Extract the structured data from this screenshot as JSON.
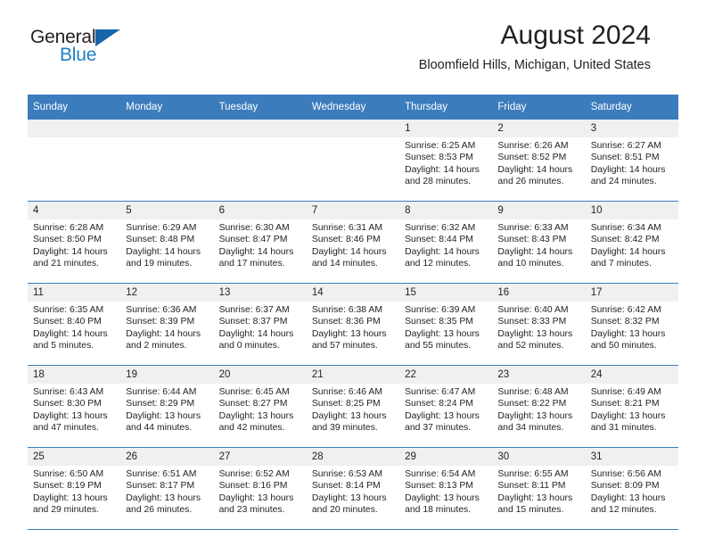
{
  "brand": {
    "name_part1": "General",
    "name_part2": "Blue",
    "color_dark": "#231f20",
    "color_blue": "#1f7fc4",
    "triangle_color": "#1565a8"
  },
  "header": {
    "title": "August 2024",
    "subtitle": "Bloomfield Hills, Michigan, United States"
  },
  "theme": {
    "header_bar": "#3b7cbd",
    "daynum_band": "#f0f0f0",
    "text": "#231f20"
  },
  "weekdays": [
    "Sunday",
    "Monday",
    "Tuesday",
    "Wednesday",
    "Thursday",
    "Friday",
    "Saturday"
  ],
  "weeks": [
    [
      {
        "day": "",
        "sunrise": "",
        "sunset": "",
        "daylight_line1": "",
        "daylight_line2": ""
      },
      {
        "day": "",
        "sunrise": "",
        "sunset": "",
        "daylight_line1": "",
        "daylight_line2": ""
      },
      {
        "day": "",
        "sunrise": "",
        "sunset": "",
        "daylight_line1": "",
        "daylight_line2": ""
      },
      {
        "day": "",
        "sunrise": "",
        "sunset": "",
        "daylight_line1": "",
        "daylight_line2": ""
      },
      {
        "day": "1",
        "sunrise": "Sunrise: 6:25 AM",
        "sunset": "Sunset: 8:53 PM",
        "daylight_line1": "Daylight: 14 hours",
        "daylight_line2": "and 28 minutes."
      },
      {
        "day": "2",
        "sunrise": "Sunrise: 6:26 AM",
        "sunset": "Sunset: 8:52 PM",
        "daylight_line1": "Daylight: 14 hours",
        "daylight_line2": "and 26 minutes."
      },
      {
        "day": "3",
        "sunrise": "Sunrise: 6:27 AM",
        "sunset": "Sunset: 8:51 PM",
        "daylight_line1": "Daylight: 14 hours",
        "daylight_line2": "and 24 minutes."
      }
    ],
    [
      {
        "day": "4",
        "sunrise": "Sunrise: 6:28 AM",
        "sunset": "Sunset: 8:50 PM",
        "daylight_line1": "Daylight: 14 hours",
        "daylight_line2": "and 21 minutes."
      },
      {
        "day": "5",
        "sunrise": "Sunrise: 6:29 AM",
        "sunset": "Sunset: 8:48 PM",
        "daylight_line1": "Daylight: 14 hours",
        "daylight_line2": "and 19 minutes."
      },
      {
        "day": "6",
        "sunrise": "Sunrise: 6:30 AM",
        "sunset": "Sunset: 8:47 PM",
        "daylight_line1": "Daylight: 14 hours",
        "daylight_line2": "and 17 minutes."
      },
      {
        "day": "7",
        "sunrise": "Sunrise: 6:31 AM",
        "sunset": "Sunset: 8:46 PM",
        "daylight_line1": "Daylight: 14 hours",
        "daylight_line2": "and 14 minutes."
      },
      {
        "day": "8",
        "sunrise": "Sunrise: 6:32 AM",
        "sunset": "Sunset: 8:44 PM",
        "daylight_line1": "Daylight: 14 hours",
        "daylight_line2": "and 12 minutes."
      },
      {
        "day": "9",
        "sunrise": "Sunrise: 6:33 AM",
        "sunset": "Sunset: 8:43 PM",
        "daylight_line1": "Daylight: 14 hours",
        "daylight_line2": "and 10 minutes."
      },
      {
        "day": "10",
        "sunrise": "Sunrise: 6:34 AM",
        "sunset": "Sunset: 8:42 PM",
        "daylight_line1": "Daylight: 14 hours",
        "daylight_line2": "and 7 minutes."
      }
    ],
    [
      {
        "day": "11",
        "sunrise": "Sunrise: 6:35 AM",
        "sunset": "Sunset: 8:40 PM",
        "daylight_line1": "Daylight: 14 hours",
        "daylight_line2": "and 5 minutes."
      },
      {
        "day": "12",
        "sunrise": "Sunrise: 6:36 AM",
        "sunset": "Sunset: 8:39 PM",
        "daylight_line1": "Daylight: 14 hours",
        "daylight_line2": "and 2 minutes."
      },
      {
        "day": "13",
        "sunrise": "Sunrise: 6:37 AM",
        "sunset": "Sunset: 8:37 PM",
        "daylight_line1": "Daylight: 14 hours",
        "daylight_line2": "and 0 minutes."
      },
      {
        "day": "14",
        "sunrise": "Sunrise: 6:38 AM",
        "sunset": "Sunset: 8:36 PM",
        "daylight_line1": "Daylight: 13 hours",
        "daylight_line2": "and 57 minutes."
      },
      {
        "day": "15",
        "sunrise": "Sunrise: 6:39 AM",
        "sunset": "Sunset: 8:35 PM",
        "daylight_line1": "Daylight: 13 hours",
        "daylight_line2": "and 55 minutes."
      },
      {
        "day": "16",
        "sunrise": "Sunrise: 6:40 AM",
        "sunset": "Sunset: 8:33 PM",
        "daylight_line1": "Daylight: 13 hours",
        "daylight_line2": "and 52 minutes."
      },
      {
        "day": "17",
        "sunrise": "Sunrise: 6:42 AM",
        "sunset": "Sunset: 8:32 PM",
        "daylight_line1": "Daylight: 13 hours",
        "daylight_line2": "and 50 minutes."
      }
    ],
    [
      {
        "day": "18",
        "sunrise": "Sunrise: 6:43 AM",
        "sunset": "Sunset: 8:30 PM",
        "daylight_line1": "Daylight: 13 hours",
        "daylight_line2": "and 47 minutes."
      },
      {
        "day": "19",
        "sunrise": "Sunrise: 6:44 AM",
        "sunset": "Sunset: 8:29 PM",
        "daylight_line1": "Daylight: 13 hours",
        "daylight_line2": "and 44 minutes."
      },
      {
        "day": "20",
        "sunrise": "Sunrise: 6:45 AM",
        "sunset": "Sunset: 8:27 PM",
        "daylight_line1": "Daylight: 13 hours",
        "daylight_line2": "and 42 minutes."
      },
      {
        "day": "21",
        "sunrise": "Sunrise: 6:46 AM",
        "sunset": "Sunset: 8:25 PM",
        "daylight_line1": "Daylight: 13 hours",
        "daylight_line2": "and 39 minutes."
      },
      {
        "day": "22",
        "sunrise": "Sunrise: 6:47 AM",
        "sunset": "Sunset: 8:24 PM",
        "daylight_line1": "Daylight: 13 hours",
        "daylight_line2": "and 37 minutes."
      },
      {
        "day": "23",
        "sunrise": "Sunrise: 6:48 AM",
        "sunset": "Sunset: 8:22 PM",
        "daylight_line1": "Daylight: 13 hours",
        "daylight_line2": "and 34 minutes."
      },
      {
        "day": "24",
        "sunrise": "Sunrise: 6:49 AM",
        "sunset": "Sunset: 8:21 PM",
        "daylight_line1": "Daylight: 13 hours",
        "daylight_line2": "and 31 minutes."
      }
    ],
    [
      {
        "day": "25",
        "sunrise": "Sunrise: 6:50 AM",
        "sunset": "Sunset: 8:19 PM",
        "daylight_line1": "Daylight: 13 hours",
        "daylight_line2": "and 29 minutes."
      },
      {
        "day": "26",
        "sunrise": "Sunrise: 6:51 AM",
        "sunset": "Sunset: 8:17 PM",
        "daylight_line1": "Daylight: 13 hours",
        "daylight_line2": "and 26 minutes."
      },
      {
        "day": "27",
        "sunrise": "Sunrise: 6:52 AM",
        "sunset": "Sunset: 8:16 PM",
        "daylight_line1": "Daylight: 13 hours",
        "daylight_line2": "and 23 minutes."
      },
      {
        "day": "28",
        "sunrise": "Sunrise: 6:53 AM",
        "sunset": "Sunset: 8:14 PM",
        "daylight_line1": "Daylight: 13 hours",
        "daylight_line2": "and 20 minutes."
      },
      {
        "day": "29",
        "sunrise": "Sunrise: 6:54 AM",
        "sunset": "Sunset: 8:13 PM",
        "daylight_line1": "Daylight: 13 hours",
        "daylight_line2": "and 18 minutes."
      },
      {
        "day": "30",
        "sunrise": "Sunrise: 6:55 AM",
        "sunset": "Sunset: 8:11 PM",
        "daylight_line1": "Daylight: 13 hours",
        "daylight_line2": "and 15 minutes."
      },
      {
        "day": "31",
        "sunrise": "Sunrise: 6:56 AM",
        "sunset": "Sunset: 8:09 PM",
        "daylight_line1": "Daylight: 13 hours",
        "daylight_line2": "and 12 minutes."
      }
    ]
  ]
}
